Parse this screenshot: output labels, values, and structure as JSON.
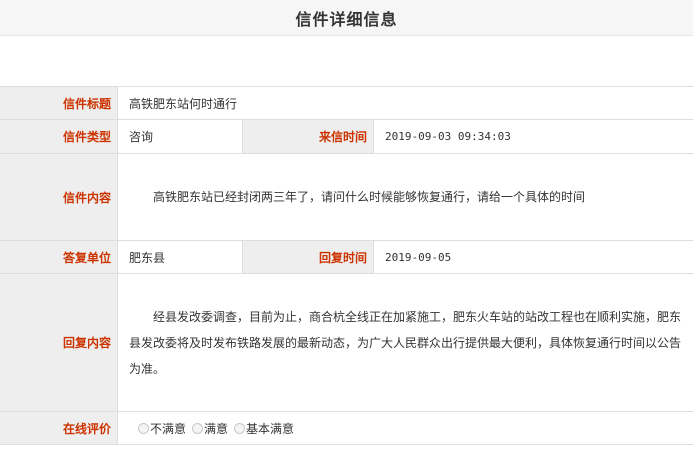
{
  "page": {
    "title": "信件详细信息"
  },
  "letter": {
    "subject_label": "信件标题",
    "subject": "高铁肥东站何时通行",
    "type_label": "信件类型",
    "type": "咨询",
    "received_label": "来信时间",
    "received": "2019-09-03 09:34:03",
    "content_label": "信件内容",
    "content": "高铁肥东站已经封闭两三年了，请问什么时候能够恢复通行，请给一个具体的时间"
  },
  "reply": {
    "unit_label": "答复单位",
    "unit": "肥东县",
    "time_label": "回复时间",
    "time": "2019-09-05",
    "content_label": "回复内容",
    "content": "经县发改委调查，目前为止，商合杭全线正在加紧施工，肥东火车站的站改工程也在顺利实施，肥东县发改委将及时发布铁路发展的最新动态，为广大人民群众出行提供最大便利，具体恢复通行时间以公告为准。"
  },
  "evaluation": {
    "label": "在线评价",
    "options": [
      "不满意",
      "满意",
      "基本满意"
    ]
  }
}
